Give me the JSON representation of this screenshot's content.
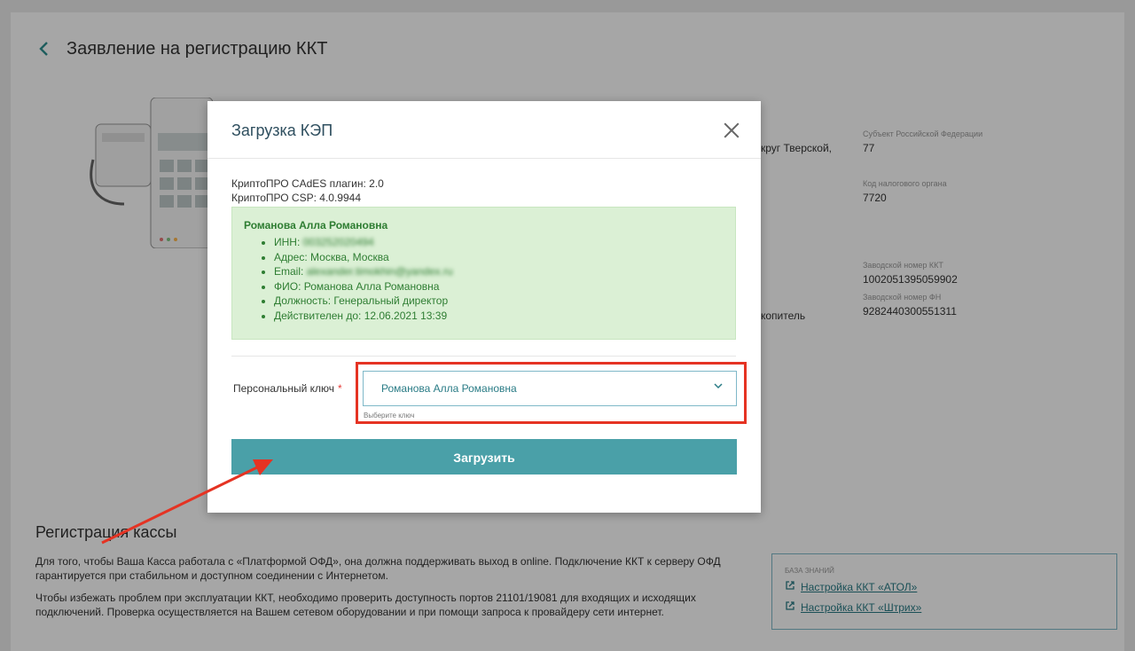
{
  "page": {
    "title": "Заявление на регистрацию ККТ",
    "info_fields": [
      {
        "label": "Субъект Российской Федерации",
        "value": "77"
      },
      {
        "label": "Код налогового органа",
        "value": "7720"
      },
      {
        "label": "Заводской номер ККТ",
        "value": "1002051395059902"
      },
      {
        "label": "Заводской номер ФН",
        "value": "9282440300551311"
      }
    ],
    "partial_text_1": "круг Тверской,",
    "partial_text_2": "копитель",
    "section_title": "Регистрация кассы",
    "paragraph_1": "Для того, чтобы Ваша Касса работала с «Платформой ОФД», она должна поддерживать выход в online. Подключение ККТ к серверу ОФД гарантируется при стабильном и доступном соединении с Интернетом.",
    "paragraph_2": "Чтобы избежать проблем при эксплуатации ККТ, необходимо проверить доступность портов 21101/19081 для входящих и исходящих подключений. Проверка осуществляется на Вашем сетевом оборудовании и при помощи запроса к провайдеру сети интернет.",
    "knowledge_base": {
      "title": "База знаний",
      "links": [
        "Настройка ККТ «АТОЛ»",
        "Настройка ККТ «Штрих»"
      ]
    }
  },
  "modal": {
    "title": "Загрузка КЭП",
    "plugin_version": "КриптоПРО CAdES плагин: 2.0",
    "csp_version": "КриптоПРО CSP: 4.0.9944",
    "certificate": {
      "name": "Романова Алла Романовна",
      "items": [
        "ИНН: 003252020494",
        "Адрес: Москва, Москва",
        "Email: alexander.timokhin@yandex.ru",
        "ФИО: Романова Алла Романовна",
        "Должность: Генеральный директор",
        "Действителен до: 12.06.2021 13:39"
      ]
    },
    "key_label": "Персональный ключ",
    "required_mark": "*",
    "selected_key": "Романова Алла Романовна",
    "key_hint": "Выберите ключ",
    "upload_label": "Загрузить"
  },
  "colors": {
    "accent": "#4aa0a8",
    "highlight": "#e53323",
    "cert_bg": "#dbf0d5",
    "cert_text": "#2e7d32"
  }
}
